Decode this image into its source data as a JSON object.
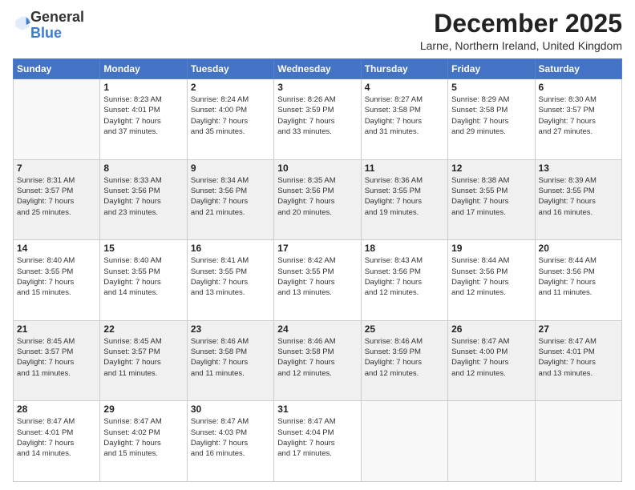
{
  "logo": {
    "general": "General",
    "blue": "Blue"
  },
  "header": {
    "month": "December 2025",
    "location": "Larne, Northern Ireland, United Kingdom"
  },
  "weekdays": [
    "Sunday",
    "Monday",
    "Tuesday",
    "Wednesday",
    "Thursday",
    "Friday",
    "Saturday"
  ],
  "weeks": [
    [
      {
        "day": "",
        "info": ""
      },
      {
        "day": "1",
        "info": "Sunrise: 8:23 AM\nSunset: 4:01 PM\nDaylight: 7 hours\nand 37 minutes."
      },
      {
        "day": "2",
        "info": "Sunrise: 8:24 AM\nSunset: 4:00 PM\nDaylight: 7 hours\nand 35 minutes."
      },
      {
        "day": "3",
        "info": "Sunrise: 8:26 AM\nSunset: 3:59 PM\nDaylight: 7 hours\nand 33 minutes."
      },
      {
        "day": "4",
        "info": "Sunrise: 8:27 AM\nSunset: 3:58 PM\nDaylight: 7 hours\nand 31 minutes."
      },
      {
        "day": "5",
        "info": "Sunrise: 8:29 AM\nSunset: 3:58 PM\nDaylight: 7 hours\nand 29 minutes."
      },
      {
        "day": "6",
        "info": "Sunrise: 8:30 AM\nSunset: 3:57 PM\nDaylight: 7 hours\nand 27 minutes."
      }
    ],
    [
      {
        "day": "7",
        "info": "Sunrise: 8:31 AM\nSunset: 3:57 PM\nDaylight: 7 hours\nand 25 minutes."
      },
      {
        "day": "8",
        "info": "Sunrise: 8:33 AM\nSunset: 3:56 PM\nDaylight: 7 hours\nand 23 minutes."
      },
      {
        "day": "9",
        "info": "Sunrise: 8:34 AM\nSunset: 3:56 PM\nDaylight: 7 hours\nand 21 minutes."
      },
      {
        "day": "10",
        "info": "Sunrise: 8:35 AM\nSunset: 3:56 PM\nDaylight: 7 hours\nand 20 minutes."
      },
      {
        "day": "11",
        "info": "Sunrise: 8:36 AM\nSunset: 3:55 PM\nDaylight: 7 hours\nand 19 minutes."
      },
      {
        "day": "12",
        "info": "Sunrise: 8:38 AM\nSunset: 3:55 PM\nDaylight: 7 hours\nand 17 minutes."
      },
      {
        "day": "13",
        "info": "Sunrise: 8:39 AM\nSunset: 3:55 PM\nDaylight: 7 hours\nand 16 minutes."
      }
    ],
    [
      {
        "day": "14",
        "info": "Sunrise: 8:40 AM\nSunset: 3:55 PM\nDaylight: 7 hours\nand 15 minutes."
      },
      {
        "day": "15",
        "info": "Sunrise: 8:40 AM\nSunset: 3:55 PM\nDaylight: 7 hours\nand 14 minutes."
      },
      {
        "day": "16",
        "info": "Sunrise: 8:41 AM\nSunset: 3:55 PM\nDaylight: 7 hours\nand 13 minutes."
      },
      {
        "day": "17",
        "info": "Sunrise: 8:42 AM\nSunset: 3:55 PM\nDaylight: 7 hours\nand 13 minutes."
      },
      {
        "day": "18",
        "info": "Sunrise: 8:43 AM\nSunset: 3:56 PM\nDaylight: 7 hours\nand 12 minutes."
      },
      {
        "day": "19",
        "info": "Sunrise: 8:44 AM\nSunset: 3:56 PM\nDaylight: 7 hours\nand 12 minutes."
      },
      {
        "day": "20",
        "info": "Sunrise: 8:44 AM\nSunset: 3:56 PM\nDaylight: 7 hours\nand 11 minutes."
      }
    ],
    [
      {
        "day": "21",
        "info": "Sunrise: 8:45 AM\nSunset: 3:57 PM\nDaylight: 7 hours\nand 11 minutes."
      },
      {
        "day": "22",
        "info": "Sunrise: 8:45 AM\nSunset: 3:57 PM\nDaylight: 7 hours\nand 11 minutes."
      },
      {
        "day": "23",
        "info": "Sunrise: 8:46 AM\nSunset: 3:58 PM\nDaylight: 7 hours\nand 11 minutes."
      },
      {
        "day": "24",
        "info": "Sunrise: 8:46 AM\nSunset: 3:58 PM\nDaylight: 7 hours\nand 12 minutes."
      },
      {
        "day": "25",
        "info": "Sunrise: 8:46 AM\nSunset: 3:59 PM\nDaylight: 7 hours\nand 12 minutes."
      },
      {
        "day": "26",
        "info": "Sunrise: 8:47 AM\nSunset: 4:00 PM\nDaylight: 7 hours\nand 12 minutes."
      },
      {
        "day": "27",
        "info": "Sunrise: 8:47 AM\nSunset: 4:01 PM\nDaylight: 7 hours\nand 13 minutes."
      }
    ],
    [
      {
        "day": "28",
        "info": "Sunrise: 8:47 AM\nSunset: 4:01 PM\nDaylight: 7 hours\nand 14 minutes."
      },
      {
        "day": "29",
        "info": "Sunrise: 8:47 AM\nSunset: 4:02 PM\nDaylight: 7 hours\nand 15 minutes."
      },
      {
        "day": "30",
        "info": "Sunrise: 8:47 AM\nSunset: 4:03 PM\nDaylight: 7 hours\nand 16 minutes."
      },
      {
        "day": "31",
        "info": "Sunrise: 8:47 AM\nSunset: 4:04 PM\nDaylight: 7 hours\nand 17 minutes."
      },
      {
        "day": "",
        "info": ""
      },
      {
        "day": "",
        "info": ""
      },
      {
        "day": "",
        "info": ""
      }
    ]
  ]
}
